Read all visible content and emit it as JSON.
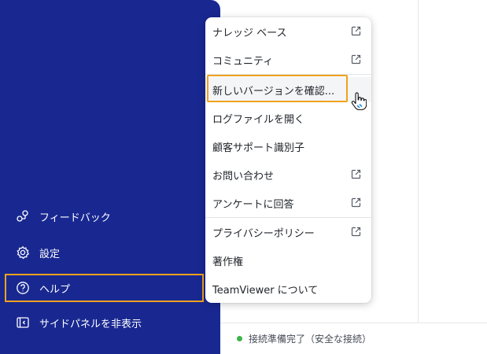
{
  "colors": {
    "sidebar_bg": "#192891",
    "highlight": "#f0a21d",
    "status_ok": "#3cb44b"
  },
  "sidebar": {
    "items": [
      {
        "label": "フィードバック",
        "icon": "feedback-icon"
      },
      {
        "label": "設定",
        "icon": "gear-icon"
      },
      {
        "label": "ヘルプ",
        "icon": "help-circle-icon"
      },
      {
        "label": "サイドパネルを非表示",
        "icon": "collapse-panel-icon"
      }
    ]
  },
  "help_menu": {
    "items": [
      {
        "label": "ナレッジ ベース",
        "external": true
      },
      {
        "label": "コミュニティ",
        "external": true
      },
      {
        "label": "新しいバージョンを確認...",
        "external": false
      },
      {
        "label": "ログファイルを開く",
        "external": false
      },
      {
        "label": "顧客サポート識別子",
        "external": false
      },
      {
        "label": "お問い合わせ",
        "external": true
      },
      {
        "label": "アンケートに回答",
        "external": true
      },
      {
        "label": "プライバシーポリシー",
        "external": true
      },
      {
        "label": "著作権",
        "external": false
      },
      {
        "label": "TeamViewer について",
        "external": false
      }
    ]
  },
  "status": {
    "text": "接続準備完了（安全な接続）"
  }
}
